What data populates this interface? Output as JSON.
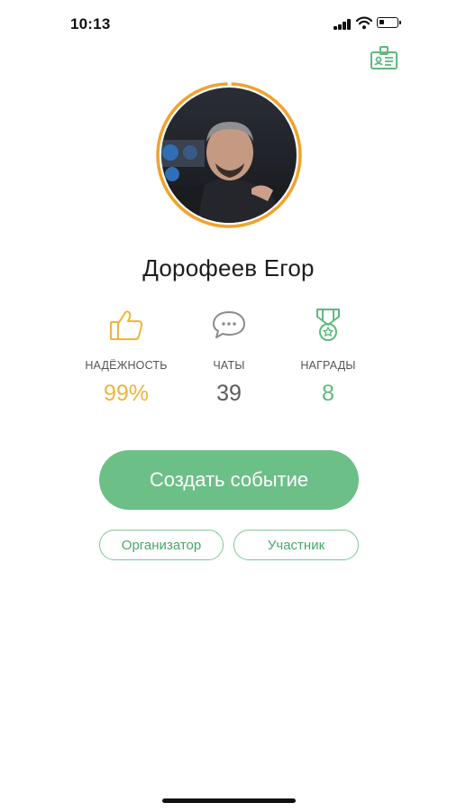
{
  "status_bar": {
    "time": "10:13"
  },
  "profile": {
    "name": "Дорофеев Егор"
  },
  "stats": {
    "reliability": {
      "label": "НАДЁЖНОСТЬ",
      "value": "99%",
      "color": "#f0b43c"
    },
    "chats": {
      "label": "ЧАТЫ",
      "value": "39",
      "color": "#5a5a5a"
    },
    "awards": {
      "label": "НАГРАДЫ",
      "value": "8",
      "color": "#5fb97c"
    }
  },
  "actions": {
    "create_event": "Создать событие",
    "organizer": "Организатор",
    "participant": "Участник"
  },
  "colors": {
    "accent_green": "#6cbf87",
    "accent_orange": "#f0a32e"
  },
  "icons": {
    "header": "id-card-icon",
    "reliability": "thumbs-up-icon",
    "chats": "chat-bubble-icon",
    "awards": "medal-icon"
  }
}
